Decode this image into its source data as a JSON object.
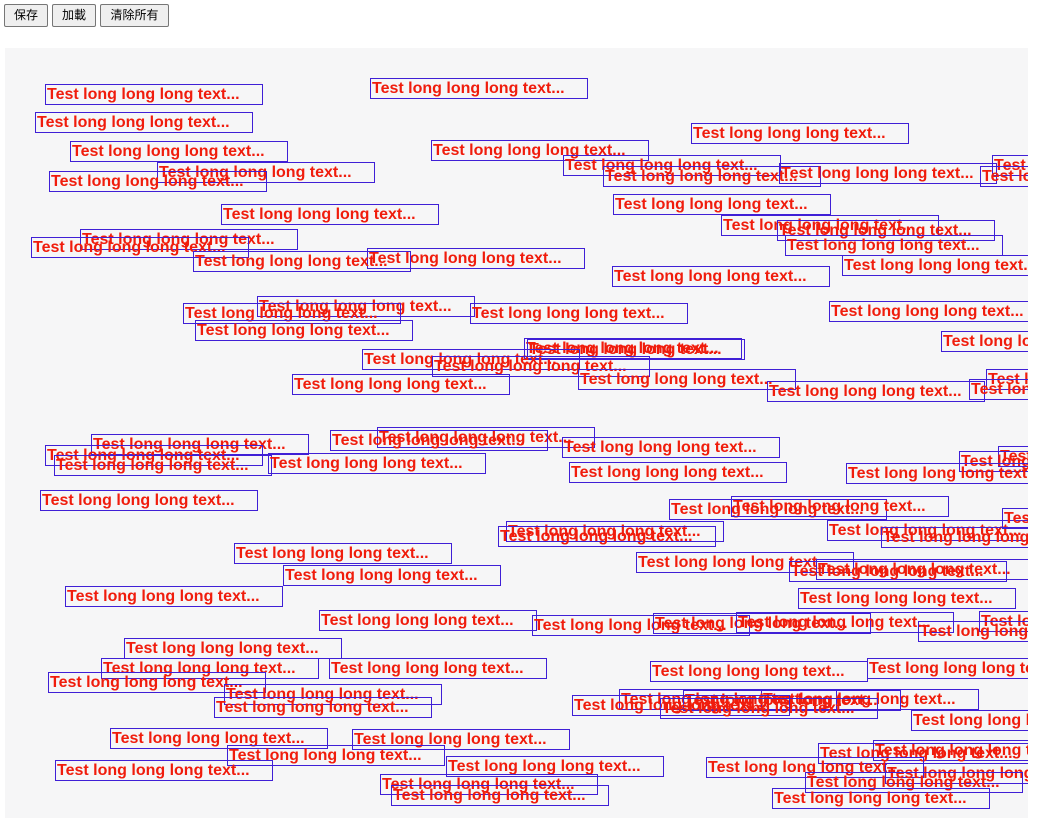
{
  "toolbar": {
    "save_label": "保存",
    "load_label": "加載",
    "clear_label": "清除所有"
  },
  "canvas": {
    "label_text": "Test long long long text...",
    "text_color": "#f01c0c",
    "border_color": "#3f1fd6",
    "background": "#f6f6f7"
  }
}
